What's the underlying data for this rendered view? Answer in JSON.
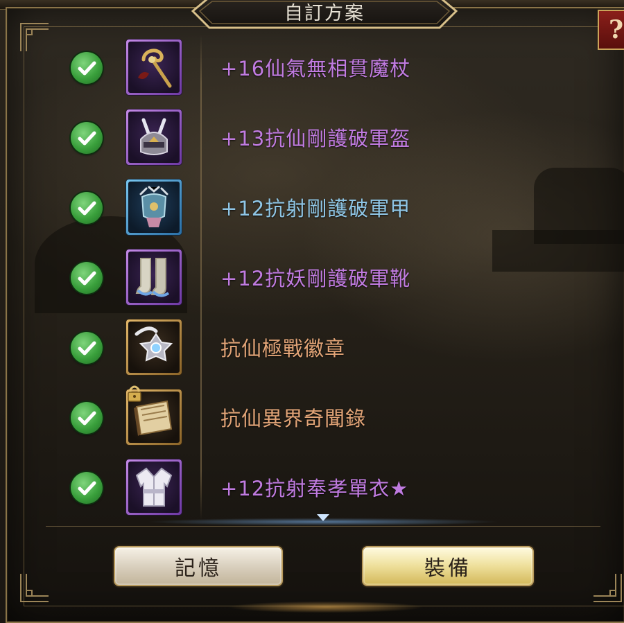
{
  "window": {
    "title": "自訂方案"
  },
  "help": {
    "label": "?"
  },
  "items": [
    {
      "name": "+16仙氣無相貫魔杖",
      "color": "#c07be0",
      "frame": "purple",
      "icon": "staff-icon",
      "checked": true,
      "locked": false
    },
    {
      "name": "+13抗仙剛護破軍盔",
      "color": "#c07be0",
      "frame": "purple",
      "icon": "helmet-icon",
      "checked": true,
      "locked": false
    },
    {
      "name": "+12抗射剛護破軍甲",
      "color": "#8fc6e6",
      "frame": "blue",
      "icon": "armor-icon",
      "checked": true,
      "locked": false
    },
    {
      "name": "+12抗妖剛護破軍靴",
      "color": "#c07be0",
      "frame": "purple",
      "icon": "boots-icon",
      "checked": true,
      "locked": false
    },
    {
      "name": "抗仙極戰徽章",
      "color": "#e2a477",
      "frame": "gold",
      "icon": "badge-icon",
      "checked": true,
      "locked": false
    },
    {
      "name": "抗仙異界奇聞錄",
      "color": "#e2a477",
      "frame": "gold",
      "icon": "book-icon",
      "checked": true,
      "locked": true
    },
    {
      "name": "+12抗射奉孝單衣★",
      "color": "#c07be0",
      "frame": "purple",
      "icon": "robe-icon",
      "checked": true,
      "locked": false
    }
  ],
  "buttons": {
    "memory": "記憶",
    "equip": "裝備"
  }
}
